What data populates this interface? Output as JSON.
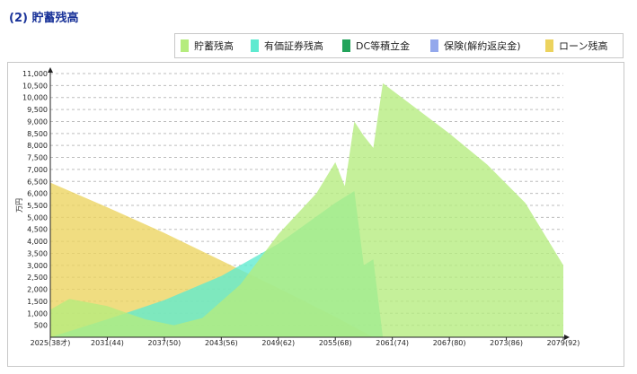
{
  "section": {
    "title": "(2) 貯蓄残高"
  },
  "legend": [
    {
      "label": "貯蓄残高",
      "color": "#b5ec7e"
    },
    {
      "label": "有価証券残高",
      "color": "#5eead0"
    },
    {
      "label": "DC等積立金",
      "color": "#22a35a"
    },
    {
      "label": "保険(解約返戻金)",
      "color": "#93a8ec"
    },
    {
      "label": "ローン残高",
      "color": "#ecd35e"
    }
  ],
  "chart_data": {
    "type": "area",
    "ylabel": "万円",
    "xlabel": "",
    "ylim": [
      0,
      11000
    ],
    "yticks": [
      500,
      1000,
      1500,
      2000,
      2500,
      3000,
      3500,
      4000,
      4500,
      5000,
      5500,
      6000,
      6500,
      7000,
      7500,
      8000,
      8500,
      9000,
      9500,
      10000,
      10500,
      11000
    ],
    "ytick_labels": [
      "500",
      "1,000",
      "1,500",
      "2,000",
      "2,500",
      "3,000",
      "3,500",
      "4,000",
      "4,500",
      "5,000",
      "5,500",
      "6,000",
      "6,500",
      "7,000",
      "7,500",
      "8,000",
      "8,500",
      "9,000",
      "9,500",
      "10,000",
      "10,500",
      "11,000"
    ],
    "xlim": [
      2025,
      2079
    ],
    "xticks": [
      2025,
      2031,
      2037,
      2043,
      2049,
      2055,
      2061,
      2067,
      2073,
      2079
    ],
    "xtick_labels": [
      "2025(38才)",
      "2031(44)",
      "2037(50)",
      "2043(56)",
      "2049(62)",
      "2055(68)",
      "2061(74)",
      "2067(80)",
      "2073(86)",
      "2079(92)"
    ],
    "grid": true,
    "legend_position": "top-right",
    "series": [
      {
        "name": "ローン残高",
        "color": "#ecd35e",
        "x": [
          2025,
          2031,
          2037,
          2043,
          2049,
          2055,
          2059
        ],
        "values": [
          6450,
          5420,
          4350,
          3200,
          2050,
          850,
          0
        ]
      },
      {
        "name": "有価証券残高",
        "color": "#5eead0",
        "x": [
          2025,
          2031,
          2037,
          2043,
          2049,
          2055,
          2057,
          2058,
          2059,
          2060
        ],
        "values": [
          0,
          750,
          1550,
          2550,
          3900,
          5600,
          6100,
          3000,
          3250,
          0
        ]
      },
      {
        "name": "貯蓄残高",
        "color": "#b5ec7e",
        "x": [
          2025,
          2027,
          2031,
          2035,
          2038,
          2041,
          2045,
          2049,
          2053,
          2055,
          2056,
          2057,
          2058,
          2059,
          2060,
          2063,
          2067,
          2071,
          2075,
          2079
        ],
        "values": [
          1150,
          1600,
          1300,
          750,
          500,
          800,
          2200,
          4300,
          6000,
          7300,
          6300,
          9000,
          8400,
          7900,
          10600,
          9700,
          8500,
          7200,
          5600,
          3000
        ]
      }
    ]
  }
}
